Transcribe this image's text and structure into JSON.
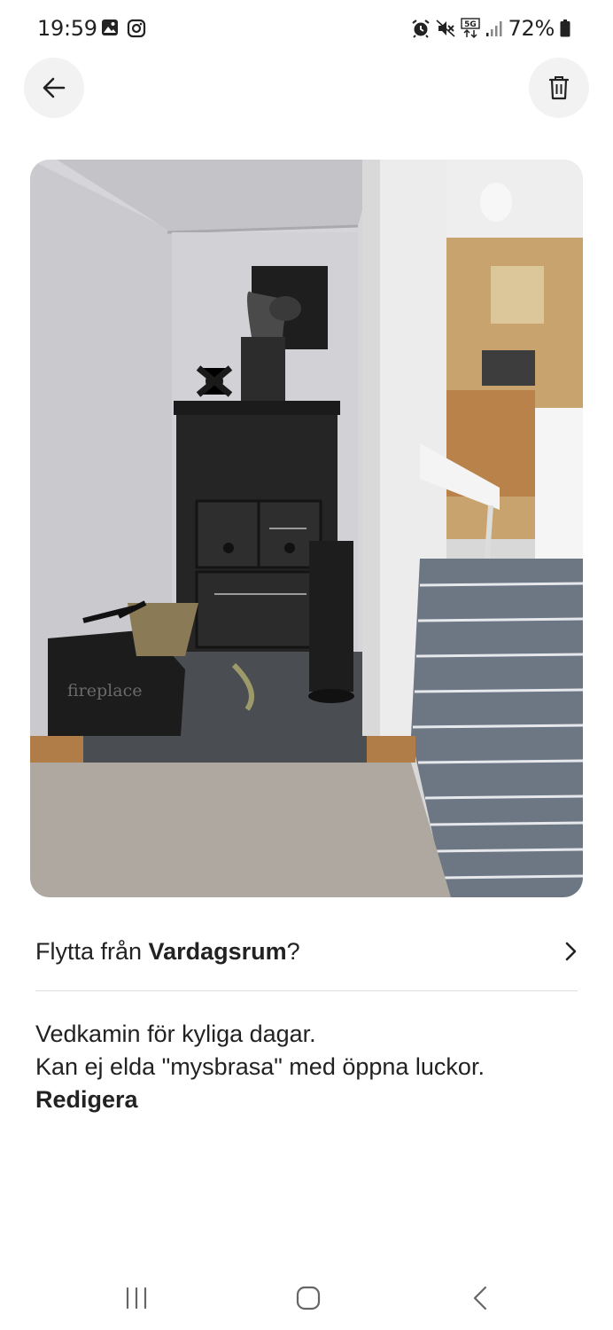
{
  "status_bar": {
    "time": "19:59",
    "battery": "72%",
    "left_icons": [
      "gallery-icon",
      "instagram-icon"
    ],
    "right_icons": [
      "alarm-icon",
      "mute-icon",
      "5g-icon",
      "signal-icon",
      "battery-icon"
    ]
  },
  "header": {
    "back_icon": "arrow-left-icon",
    "delete_icon": "trash-icon"
  },
  "photo": {
    "embedded_text": "fireplace"
  },
  "move": {
    "prefix": "Flytta från ",
    "room": "Vardagsrum",
    "suffix": "?",
    "chevron_icon": "chevron-right-icon"
  },
  "description": {
    "line1": "Vedkamin för kyliga dagar.",
    "line2": "Kan ej elda \"mysbrasa\" med öppna luckor.",
    "edit_label": "Redigera"
  },
  "nav": {
    "recents_icon": "recents-icon",
    "home_icon": "home-icon",
    "back_icon": "nav-back-icon"
  },
  "colors": {
    "text": "#222222",
    "button_bg": "#f2f2f2",
    "divider": "#dddddd"
  }
}
